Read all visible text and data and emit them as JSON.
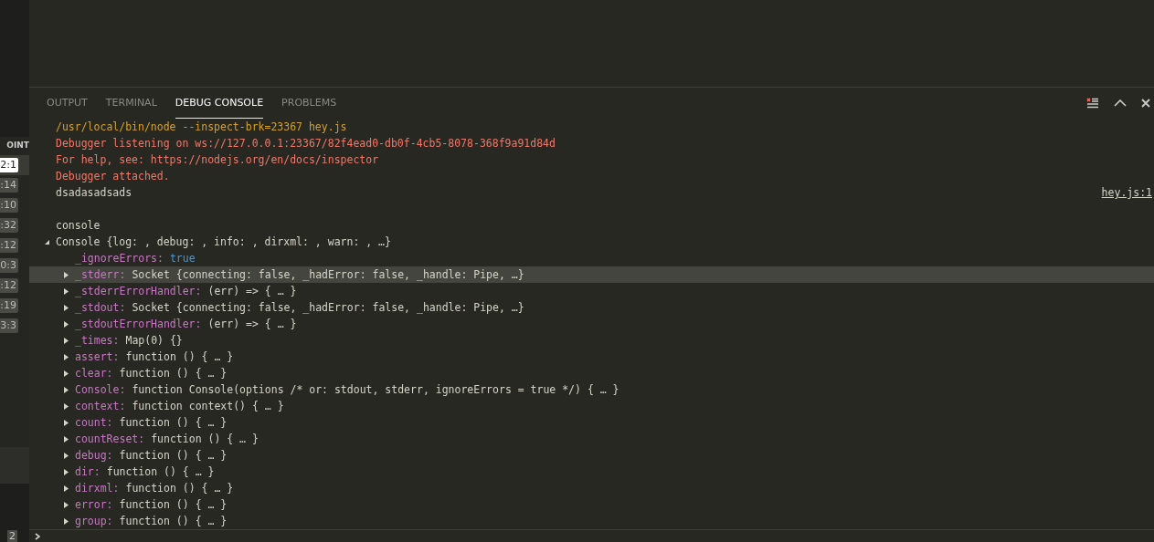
{
  "sidebar": {
    "header": "OINT",
    "badges": [
      {
        "label": "2:1",
        "selected": true
      },
      {
        "label": ":14",
        "selected": false
      },
      {
        "label": ":10",
        "selected": false
      },
      {
        "label": ":32",
        "selected": false
      },
      {
        "label": ":12",
        "selected": false
      },
      {
        "label": "0:3",
        "selected": false
      },
      {
        "label": ":12",
        "selected": false
      },
      {
        "label": ":19",
        "selected": false
      },
      {
        "label": "3:3",
        "selected": false
      }
    ],
    "footer_badge": "2"
  },
  "panel": {
    "tabs": [
      {
        "label": "OUTPUT",
        "selected": false
      },
      {
        "label": "TERMINAL",
        "selected": false
      },
      {
        "label": "DEBUG CONSOLE",
        "selected": true
      },
      {
        "label": "PROBLEMS",
        "selected": false
      }
    ]
  },
  "console": {
    "lines": [
      {
        "kind": "command",
        "text": "/usr/local/bin/node --inspect-brk=23367 hey.js"
      },
      {
        "kind": "error",
        "text": "Debugger listening on ws://127.0.0.1:23367/82f4ead0-db0f-4cb5-8078-368f9a91d84d"
      },
      {
        "kind": "error",
        "text": "For help, see: https://nodejs.org/en/docs/inspector"
      },
      {
        "kind": "error",
        "text": "Debugger attached."
      },
      {
        "kind": "log",
        "text": "dsadasadsads",
        "source": "hey.js:1"
      },
      {
        "kind": "spacer"
      },
      {
        "kind": "log",
        "text": "console"
      }
    ],
    "tree": {
      "label": "Console {log: , debug: , info: , dirxml: , warn: , …}",
      "expanded": true,
      "children": [
        {
          "key": "_ignoreErrors:",
          "value": "true",
          "kind": "boolean",
          "expandable": false,
          "selected": false
        },
        {
          "key": "_stderr:",
          "value": "Socket {connecting: false, _hadError: false, _handle: Pipe, …}",
          "kind": "object",
          "expandable": true,
          "selected": true
        },
        {
          "key": "_stderrErrorHandler:",
          "value": "(err) => { … }",
          "kind": "object",
          "expandable": true,
          "selected": false
        },
        {
          "key": "_stdout:",
          "value": "Socket {connecting: false, _hadError: false, _handle: Pipe, …}",
          "kind": "object",
          "expandable": true,
          "selected": false
        },
        {
          "key": "_stdoutErrorHandler:",
          "value": "(err) => { … }",
          "kind": "object",
          "expandable": true,
          "selected": false
        },
        {
          "key": "_times:",
          "value": "Map(0) {}",
          "kind": "object",
          "expandable": true,
          "selected": false
        },
        {
          "key": "assert:",
          "value": "function () { … }",
          "kind": "object",
          "expandable": true,
          "selected": false
        },
        {
          "key": "clear:",
          "value": "function () { … }",
          "kind": "object",
          "expandable": true,
          "selected": false
        },
        {
          "key": "Console:",
          "value": "function Console(options /* or: stdout, stderr, ignoreErrors = true */) { … }",
          "kind": "object",
          "expandable": true,
          "selected": false
        },
        {
          "key": "context:",
          "value": "function context() { … }",
          "kind": "object",
          "expandable": true,
          "selected": false
        },
        {
          "key": "count:",
          "value": "function () { … }",
          "kind": "object",
          "expandable": true,
          "selected": false
        },
        {
          "key": "countReset:",
          "value": "function () { … }",
          "kind": "object",
          "expandable": true,
          "selected": false
        },
        {
          "key": "debug:",
          "value": "function () { … }",
          "kind": "object",
          "expandable": true,
          "selected": false
        },
        {
          "key": "dir:",
          "value": "function () { … }",
          "kind": "object",
          "expandable": true,
          "selected": false
        },
        {
          "key": "dirxml:",
          "value": "function () { … }",
          "kind": "object",
          "expandable": true,
          "selected": false
        },
        {
          "key": "error:",
          "value": "function () { … }",
          "kind": "object",
          "expandable": true,
          "selected": false
        },
        {
          "key": "group:",
          "value": "function () { … }",
          "kind": "object",
          "expandable": true,
          "selected": false
        }
      ]
    }
  }
}
